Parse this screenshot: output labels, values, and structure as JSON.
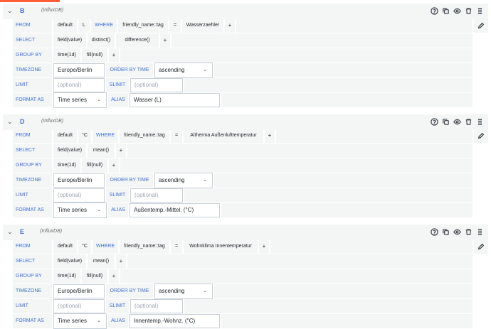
{
  "accent_color": "#ff5f38",
  "labels": {
    "from": "FROM",
    "select": "SELECT",
    "group_by": "GROUP BY",
    "timezone": "TIMEZONE",
    "limit": "LIMIT",
    "format_as": "FORMAT AS",
    "where": "WHERE",
    "order_by_time": "ORDER BY TIME",
    "slimit": "SLIMIT",
    "alias": "ALIAS",
    "plus": "+",
    "eq": "="
  },
  "header_icons": [
    "help-icon",
    "copy-icon",
    "eye-icon",
    "trash-icon",
    "drag-handle-icon"
  ],
  "queries": [
    {
      "ref_id": "B",
      "datasource": "(InfluxDB)",
      "from": {
        "policy": "default",
        "measurement": "L",
        "tag_key": "friendly_name::tag",
        "tag_value": "Wasserzaehler"
      },
      "select": [
        "field(value)",
        "distinct()",
        "difference()"
      ],
      "group_by": [
        "time(1d)",
        "fill(null)"
      ],
      "timezone": "Europe/Berlin",
      "order_by_time": "ascending",
      "limit_placeholder": "(optional)",
      "slimit_placeholder": "(optional)",
      "format_as": "Time series",
      "alias": "Wasser (L)"
    },
    {
      "ref_id": "D",
      "datasource": "(InfluxDB)",
      "from": {
        "policy": "default",
        "measurement": "°C",
        "tag_key": "friendly_name::tag",
        "tag_value": "Altherma Außenlufttemperatur"
      },
      "select": [
        "field(value)",
        "mean()"
      ],
      "group_by": [
        "time(1d)",
        "fill(null)"
      ],
      "timezone": "Europe/Berlin",
      "order_by_time": "ascending",
      "limit_placeholder": "(optional)",
      "slimit_placeholder": "(optional)",
      "format_as": "Time series",
      "alias": "Außentemp.-Mittel. (°C)"
    },
    {
      "ref_id": "E",
      "datasource": "(InfluxDB)",
      "from": {
        "policy": "default",
        "measurement": "°C",
        "tag_key": "friendly_name::tag",
        "tag_value": "Wohnklima Innentemperatur"
      },
      "select": [
        "field(value)",
        "mean()"
      ],
      "group_by": [
        "time(1d)",
        "fill(null)"
      ],
      "timezone": "Europe/Berlin",
      "order_by_time": "ascending",
      "limit_placeholder": "(optional)",
      "slimit_placeholder": "(optional)",
      "format_as": "Time series",
      "alias": "Innentemp.-Wohnz. (°C)"
    }
  ]
}
